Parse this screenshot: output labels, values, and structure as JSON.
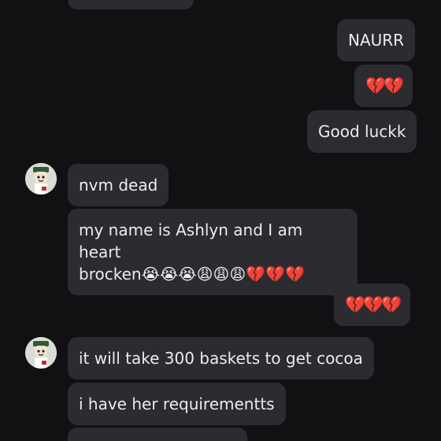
{
  "messages": {
    "top_partial": "",
    "naurr": "NAURR",
    "hearts_1": "💔💔",
    "good_luck": "Good luckk",
    "nvm_dead": "nvm dead",
    "ashlyn_line1": "my name is Ashlyn and I am heart",
    "ashlyn_line2": "brocken",
    "ashlyn_emojis": "😭😭😭😩😩😩💔💔💔",
    "hearts_2": "💔💔💔",
    "baskets": "it will take 300 baskets to get cocoa",
    "requirements": "i have her requirementts",
    "bottom_partial": ""
  },
  "avatar": {
    "icon": "roblox-avatar-icon"
  },
  "colors": {
    "background": "#111114",
    "bubble": "#2b2b30",
    "text": "#ececf0",
    "heart": "#e0324a"
  }
}
